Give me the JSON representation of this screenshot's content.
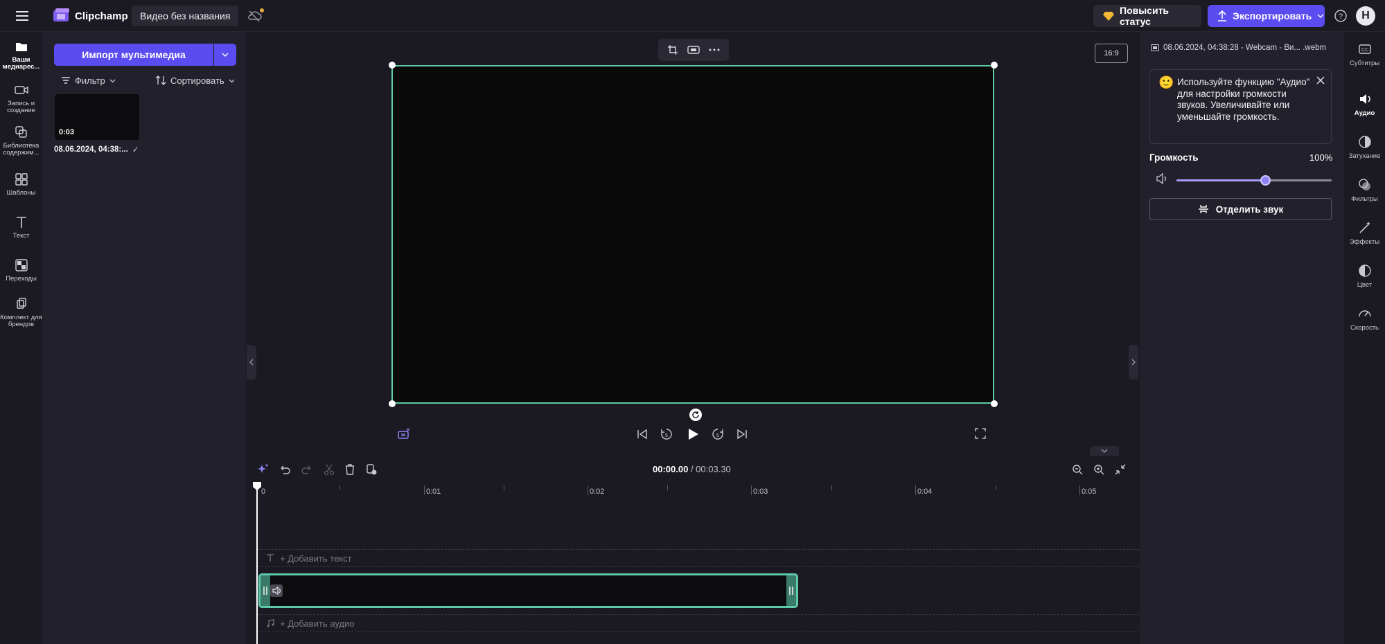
{
  "app": {
    "name": "Clipchamp",
    "project_title": "Видео без названия",
    "upgrade_label": "Повысить статус",
    "export_label": "Экспортировать",
    "avatar_initial": "Н"
  },
  "left_nav": {
    "items": [
      {
        "label": "Ваши медиарес...",
        "icon": "folder-icon",
        "active": true
      },
      {
        "label": "Запись и создание",
        "icon": "camera-icon",
        "active": false
      },
      {
        "label": "Библиотека содержим...",
        "icon": "library-icon",
        "active": false
      },
      {
        "label": "Шаблоны",
        "icon": "templates-icon",
        "active": false
      },
      {
        "label": "Текст",
        "icon": "text-icon",
        "active": false
      },
      {
        "label": "Переходы",
        "icon": "transitions-icon",
        "active": false
      },
      {
        "label": "Комплект для брендов",
        "icon": "brand-kit-icon",
        "active": false
      }
    ]
  },
  "media": {
    "import_label": "Импорт мультимедиа",
    "filter_label": "Фильтр",
    "sort_label": "Сортировать",
    "items": [
      {
        "duration": "0:03",
        "name": "08.06.2024, 04:38:...",
        "used": "✓"
      }
    ]
  },
  "preview": {
    "aspect_ratio": "16:9"
  },
  "timeline": {
    "current_time": "00:00.00",
    "total_time": "/ 00:03.30",
    "ruler_labels": [
      "0",
      "0:01",
      "0:02",
      "0:03",
      "0:04",
      "0:05"
    ],
    "add_text_label": "+ Добавить текст",
    "add_audio_label": "+ Добавить аудио"
  },
  "properties": {
    "file_name": "08.06.2024, 04:38:28 - Webcam - Ви... .webm",
    "tip_text": "Используйте функцию \"Аудио\" для настройки громкости звуков. Увеличивайте или уменьшайте громкость.",
    "volume_label": "Громкость",
    "volume_value": "100%",
    "volume_fraction": 0.57,
    "detach_label": "Отделить звук"
  },
  "right_nav": {
    "items": [
      {
        "label": "Субтитры",
        "icon": "captions-icon",
        "active": false
      },
      {
        "label": "Аудио",
        "icon": "audio-icon",
        "active": true
      },
      {
        "label": "Затухание",
        "icon": "fade-icon",
        "active": false
      },
      {
        "label": "Фильтры",
        "icon": "filters-icon",
        "active": false
      },
      {
        "label": "Эффекты",
        "icon": "effects-icon",
        "active": false
      },
      {
        "label": "Цвет",
        "icon": "color-icon",
        "active": false
      },
      {
        "label": "Скорость",
        "icon": "speed-icon",
        "active": false
      }
    ]
  },
  "colors": {
    "accent": "#5b4cf0",
    "clip_border": "#5ec9a8",
    "background": "#1b1a22",
    "panel": "#22212b"
  }
}
